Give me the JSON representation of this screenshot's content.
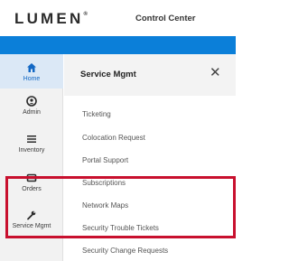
{
  "header": {
    "logo_text": "LUMEN",
    "logo_mark": "®",
    "app_title": "Control Center"
  },
  "rail": {
    "items": [
      {
        "label": "Home",
        "icon": "home-icon",
        "active": true
      },
      {
        "label": "Admin",
        "icon": "user-circle-icon",
        "active": false
      },
      {
        "label": "Inventory",
        "icon": "list-icon",
        "active": false
      },
      {
        "label": "Orders",
        "icon": "box-icon",
        "active": false
      },
      {
        "label": "Service Mgmt",
        "icon": "wrench-icon",
        "active": false
      }
    ]
  },
  "panel": {
    "title": "Service Mgmt",
    "close_glyph": "✕",
    "items": [
      "Ticketing",
      "Colocation Request",
      "Portal Support",
      "Subscriptions",
      "Network Maps",
      "Security Trouble Tickets",
      "Security Change Requests"
    ]
  },
  "colors": {
    "accent_blue": "#0b7fd9",
    "highlight_red": "#c8102e"
  }
}
